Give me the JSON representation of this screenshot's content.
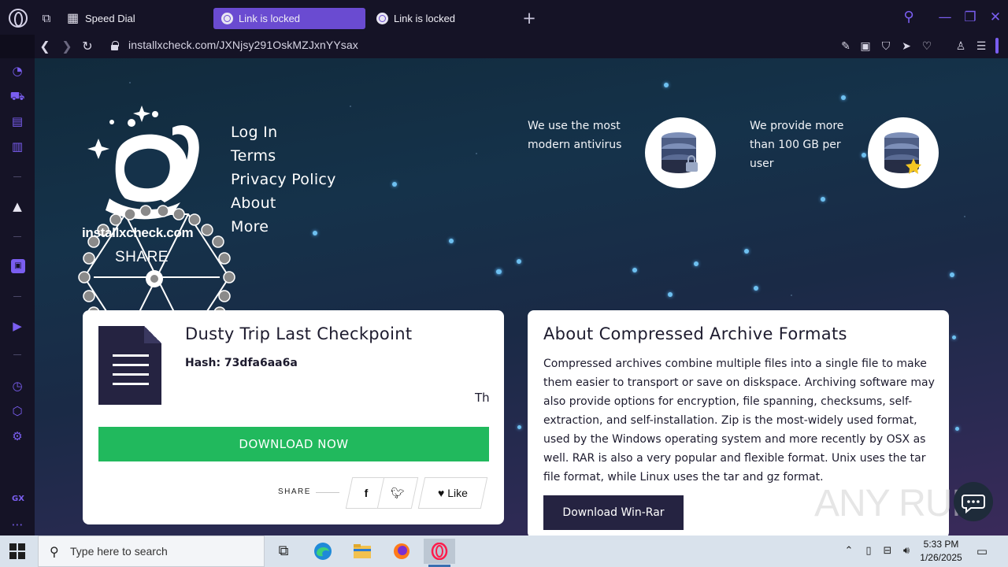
{
  "browser": {
    "tabs": [
      {
        "label": "Speed Dial",
        "active": false
      },
      {
        "label": "Link is locked",
        "active": true
      },
      {
        "label": "Link is locked",
        "active": false
      }
    ],
    "url": "installxcheck.com/JXNjsy291OskMZJxnYYsax",
    "accent_color": "#7a5ef0"
  },
  "page": {
    "site_name": "installxcheck.com",
    "share_label": "SHARE",
    "nav": [
      {
        "label": "Log In"
      },
      {
        "label": "Terms"
      },
      {
        "label": "Privacy Policy"
      },
      {
        "label": "About"
      },
      {
        "label": "More"
      }
    ],
    "features": [
      {
        "text": "We use the most modern antivirus",
        "icon": "database-lock-icon"
      },
      {
        "text": "We provide more than 100 GB per user",
        "icon": "database-star-icon"
      }
    ],
    "download_card": {
      "title": "Dusty Trip Last Checkpoint",
      "hash": "Hash: 73dfa6aa6a",
      "marquee": "Th",
      "download_label": "DOWNLOAD NOW",
      "share_label": "SHARE",
      "like_label": "Like",
      "button_color": "#21b95d"
    },
    "about_card": {
      "title": "About Compressed Archive Formats",
      "text": "Compressed archives combine multiple files into a single file to make them easier to transport or save on diskspace. Archiving software may also provide options for encryption, file spanning, checksums, self-extraction, and self-installation. Zip is the most-widely used format, used by the Windows operating system and more recently by OSX as well. RAR is also a very popular and flexible format. Unix uses the tar file format, while Linux uses the tar and gz format.",
      "button_label": "Download Win-Rar"
    },
    "watermark": "ANY RUN"
  },
  "taskbar": {
    "search_placeholder": "Type here to search",
    "time": "5:33 PM",
    "date": "1/26/2025"
  }
}
